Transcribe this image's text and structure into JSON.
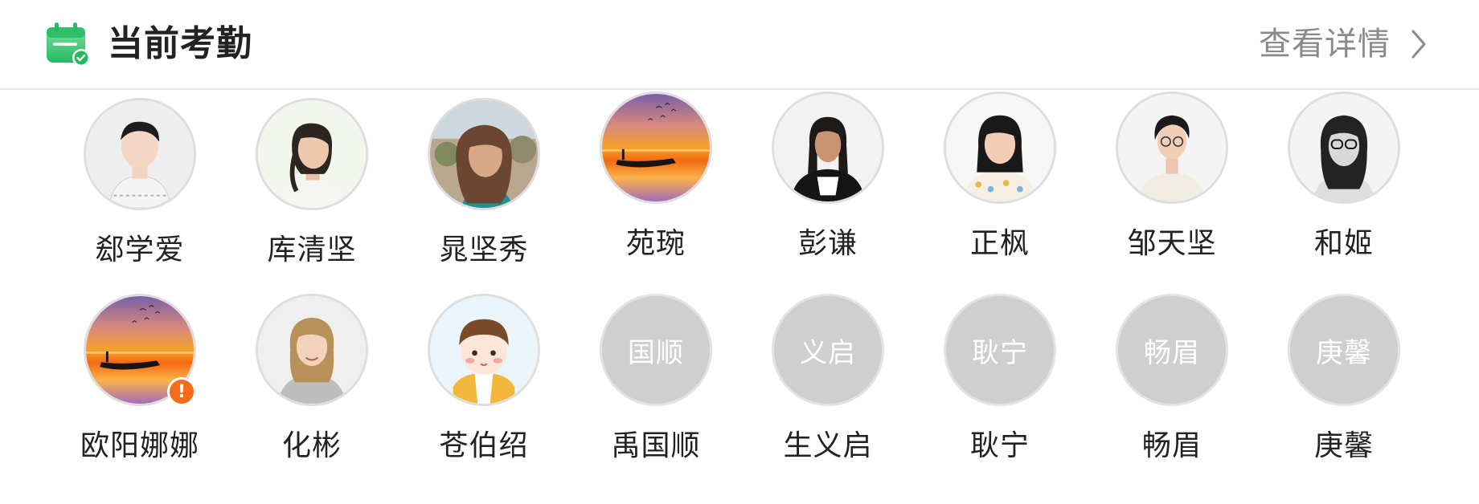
{
  "header": {
    "title": "当前考勤",
    "detail_label": "查看详情",
    "icon": "calendar-check-icon"
  },
  "colors": {
    "brand_green": "#2ec46a",
    "badge_orange": "#f76b1c",
    "placeholder_gray": "#cfcfcf"
  },
  "people": [
    {
      "name": "郄学爱",
      "avatar": "photo-man"
    },
    {
      "name": "库清坚",
      "avatar": "photo-woman-ponytail"
    },
    {
      "name": "晁坚秀",
      "avatar": "photo-woman-longhair"
    },
    {
      "name": "苑琬",
      "avatar": "photo-sunset-boat"
    },
    {
      "name": "彭谦",
      "avatar": "photo-man-longhair"
    },
    {
      "name": "正枫",
      "avatar": "photo-woman-floral"
    },
    {
      "name": "邹天坚",
      "avatar": "photo-woman-shorthair"
    },
    {
      "name": "和姬",
      "avatar": "photo-woman-glasses"
    },
    {
      "name": "欧阳娜娜",
      "avatar": "photo-sunset-boat",
      "badge": "!"
    },
    {
      "name": "化彬",
      "avatar": "photo-woman-blonde"
    },
    {
      "name": "苍伯绍",
      "avatar": "cartoon-avatar"
    },
    {
      "name": "禹国顺",
      "initials": "国顺"
    },
    {
      "name": "生义启",
      "initials": "义启"
    },
    {
      "name": "耿宁",
      "initials": "耿宁"
    },
    {
      "name": "畅眉",
      "initials": "畅眉"
    },
    {
      "name": "庚馨",
      "initials": "庚馨"
    }
  ]
}
